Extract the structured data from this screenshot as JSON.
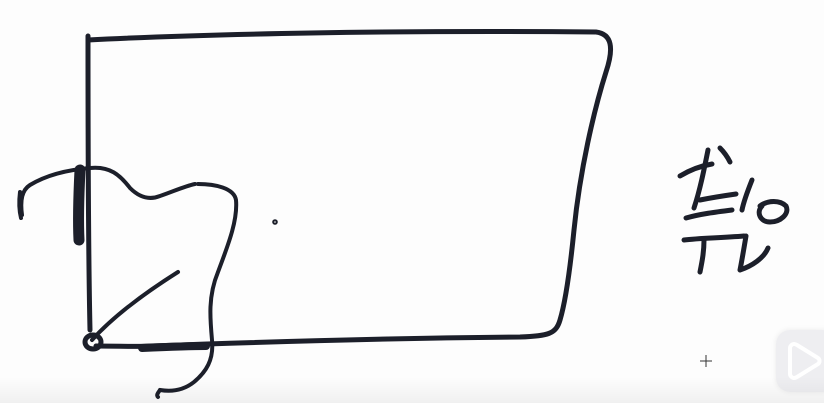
{
  "whiteboard": {
    "background": "#fdfdfd",
    "ink_color": "#1c1f2a",
    "overlay_color": "#ebebee"
  },
  "icons": {
    "cursor": "crosshair-cursor-icon",
    "play": "play-icon"
  }
}
